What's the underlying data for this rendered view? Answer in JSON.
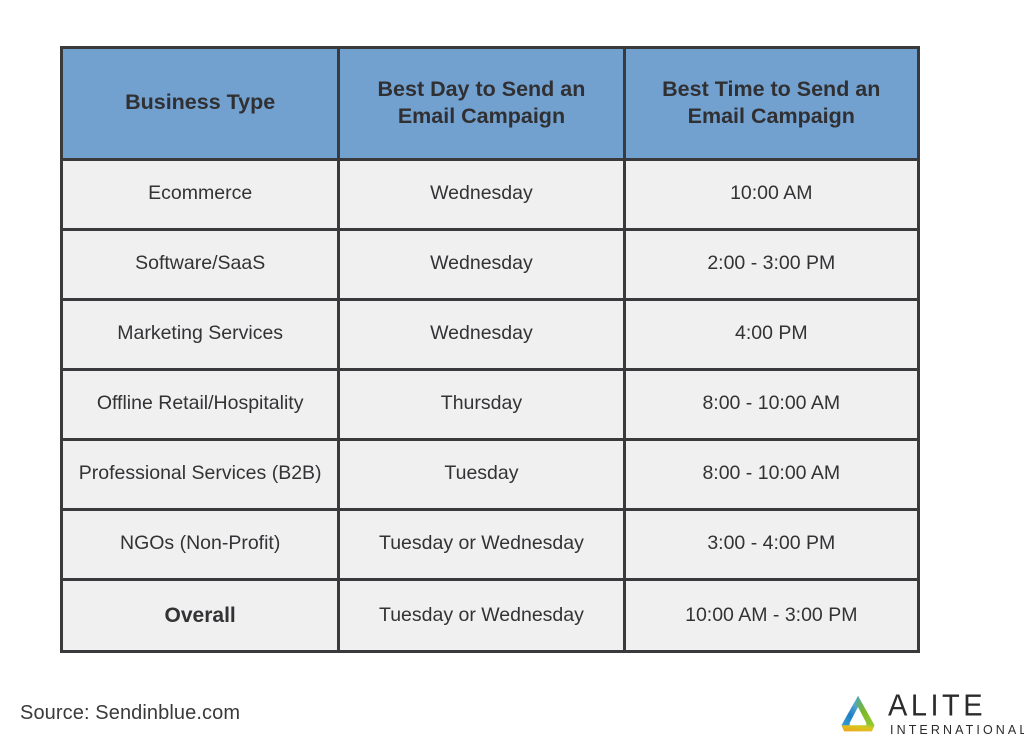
{
  "table": {
    "headers": [
      "Business Type",
      "Best Day to Send an Email Campaign",
      "Best Time to Send an Email Campaign"
    ],
    "rows": [
      {
        "type": "Ecommerce",
        "day": "Wednesday",
        "time": "10:00 AM"
      },
      {
        "type": "Software/SaaS",
        "day": "Wednesday",
        "time": "2:00 - 3:00 PM"
      },
      {
        "type": "Marketing Services",
        "day": "Wednesday",
        "time": "4:00 PM"
      },
      {
        "type": "Offline Retail/Hospitality",
        "day": "Thursday",
        "time": "8:00 - 10:00 AM"
      },
      {
        "type": "Professional Services (B2B)",
        "day": "Tuesday",
        "time": "8:00 - 10:00 AM"
      },
      {
        "type": "NGOs (Non-Profit)",
        "day": "Tuesday or Wednesday",
        "time": "3:00 - 4:00 PM"
      },
      {
        "type": "Overall",
        "day": "Tuesday or Wednesday",
        "time": "10:00 AM - 3:00 PM"
      }
    ]
  },
  "footer": {
    "source": "Source: Sendinblue.com"
  },
  "logo": {
    "name": "ALITE",
    "tagline": "INTERNATIONAL",
    "mark": "triangle-loop-logo-icon",
    "colors": {
      "blue": "#1f7fc4",
      "green": "#7ab828",
      "orange": "#f0a31a",
      "yellow": "#d9c522"
    }
  },
  "colors": {
    "header_bg": "#72A0CF",
    "cell_bg": "#f0f0f0",
    "border": "#3a3a3c",
    "text": "#333336",
    "page_bg": "#ffffff"
  }
}
